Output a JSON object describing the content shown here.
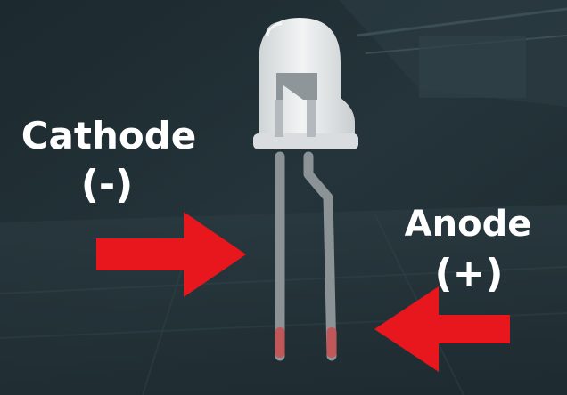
{
  "labels": {
    "cathode_name": "Cathode",
    "cathode_sign": "(-)",
    "anode_name": "Anode",
    "anode_sign": "(+)"
  },
  "colors": {
    "background": "#1f2c31",
    "arrow": "#e8171d",
    "text": "#ffffff",
    "led_body": "#e6e9ea",
    "lead": "#8b9396",
    "lead_tip": "#c0585a"
  },
  "icons": {
    "component": "led-icon",
    "pointer": "arrow-icon"
  }
}
